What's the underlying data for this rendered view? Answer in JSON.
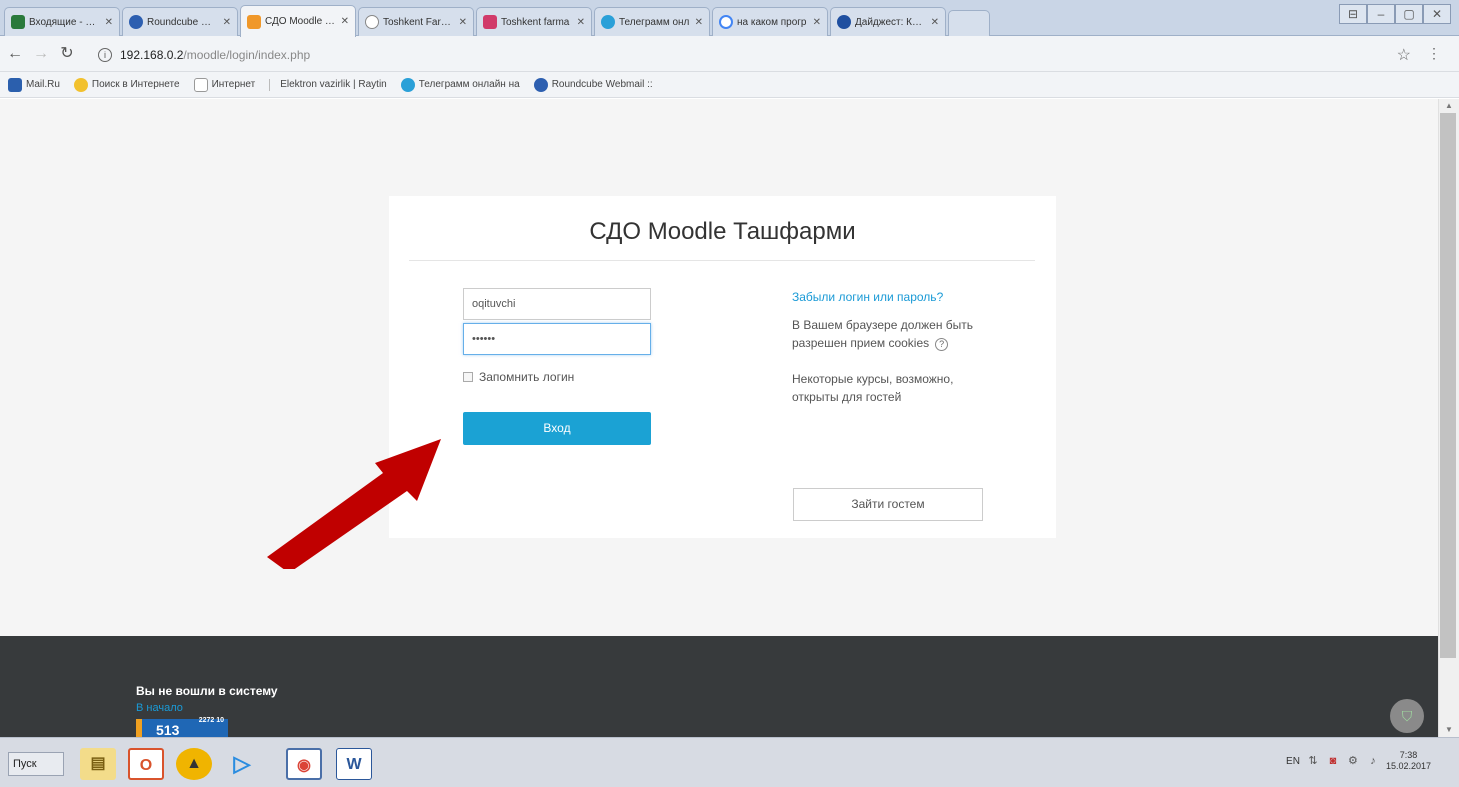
{
  "tabs": [
    {
      "title": "Входящие - Поч",
      "color": "#2a7a3c"
    },
    {
      "title": "Roundcube Web",
      "color": "#2d5fb0"
    },
    {
      "title": "СДО Moodle Таш",
      "color": "#f0982a"
    },
    {
      "title": "Toshkent Farma",
      "color": "#888888"
    },
    {
      "title": "Toshkent farma",
      "color": "#d13a6a"
    },
    {
      "title": "Телеграмм онл",
      "color": "#2aa0d8"
    },
    {
      "title": "на каком прогр",
      "color": "#4285f4"
    },
    {
      "title": "Дайджест: Крас",
      "color": "#1f4fa0"
    }
  ],
  "address": {
    "host": "192.168.0.2",
    "path": "/moodle/login/index.php"
  },
  "bookmarks": [
    {
      "label": "Mail.Ru",
      "color": "#2b5fad"
    },
    {
      "label": "Поиск в Интернете",
      "color": "#f2c12e"
    },
    {
      "label": "Интернет",
      "color": "#cfd6df"
    },
    {
      "label": "Elektron vazirlik | Raytin",
      "color": ""
    },
    {
      "label": "Телеграмм онлайн на",
      "color": "#2aa0d8"
    },
    {
      "label": "Roundcube Webmail ::",
      "color": "#2d5fb0"
    }
  ],
  "login": {
    "title": "СДО Moodle Ташфарми",
    "username_value": "oqituvchi",
    "password_value": "••••••",
    "remember_label": "Запомнить логин",
    "login_button": "Вход",
    "forgot_link": "Забыли логин или пароль?",
    "cookie_text": "В Вашем браузере должен быть разрешен прием cookies",
    "guest_text": "Некоторые курсы, возможно, открыты для гостей",
    "guest_button": "Зайти гостем"
  },
  "footer": {
    "not_logged_in": "Вы не вошли в систему",
    "home_link": "В начало",
    "counter_value": "513",
    "counter_small": "2272 10"
  },
  "taskbar": {
    "start_label": "Пуск",
    "lang": "EN",
    "time": "7:38",
    "date": "15.02.2017"
  },
  "colors": {
    "accent": "#1ba2d4",
    "link": "#1a9ad6",
    "footer_bg": "#373a3c",
    "arrow": "#c00000"
  }
}
